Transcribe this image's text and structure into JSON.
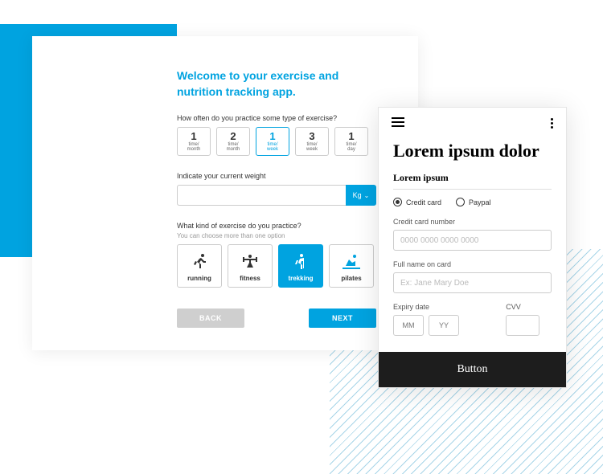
{
  "wizard": {
    "title": "Welcome to your exercise and nutrition tracking app.",
    "q1": "How often do you practice some type of exercise?",
    "freq": [
      {
        "num": "1",
        "unit": "time/\nmonth"
      },
      {
        "num": "2",
        "unit": "time/\nmonth"
      },
      {
        "num": "1",
        "unit": "time/\nweek"
      },
      {
        "num": "3",
        "unit": "time/\nweek"
      },
      {
        "num": "1",
        "unit": "time/\nday"
      }
    ],
    "freq_selected_index": 2,
    "q2": "Indicate your current weight",
    "weight_value": "",
    "unit": "Kg",
    "q3": "What kind of exercise do you practice?",
    "q3_sub": "You can choose more than one option",
    "exercises": [
      "running",
      "fitness",
      "trekking",
      "pilates"
    ],
    "exercise_selected_index": 2,
    "back": "BACK",
    "next": "NEXT"
  },
  "payment": {
    "title": "Lorem ipsum dolor",
    "subtitle": "Lorem ipsum",
    "options": [
      "Credit card",
      "Paypal"
    ],
    "selected_option_index": 0,
    "cc_label": "Credit card number",
    "cc_placeholder": "0000 0000 0000 0000",
    "name_label": "Full name on card",
    "name_placeholder": "Ex: Jane Mary Doe",
    "expiry_label": "Expiry date",
    "mm_placeholder": "MM",
    "yy_placeholder": "YY",
    "cvv_label": "CVV",
    "button": "Button"
  }
}
